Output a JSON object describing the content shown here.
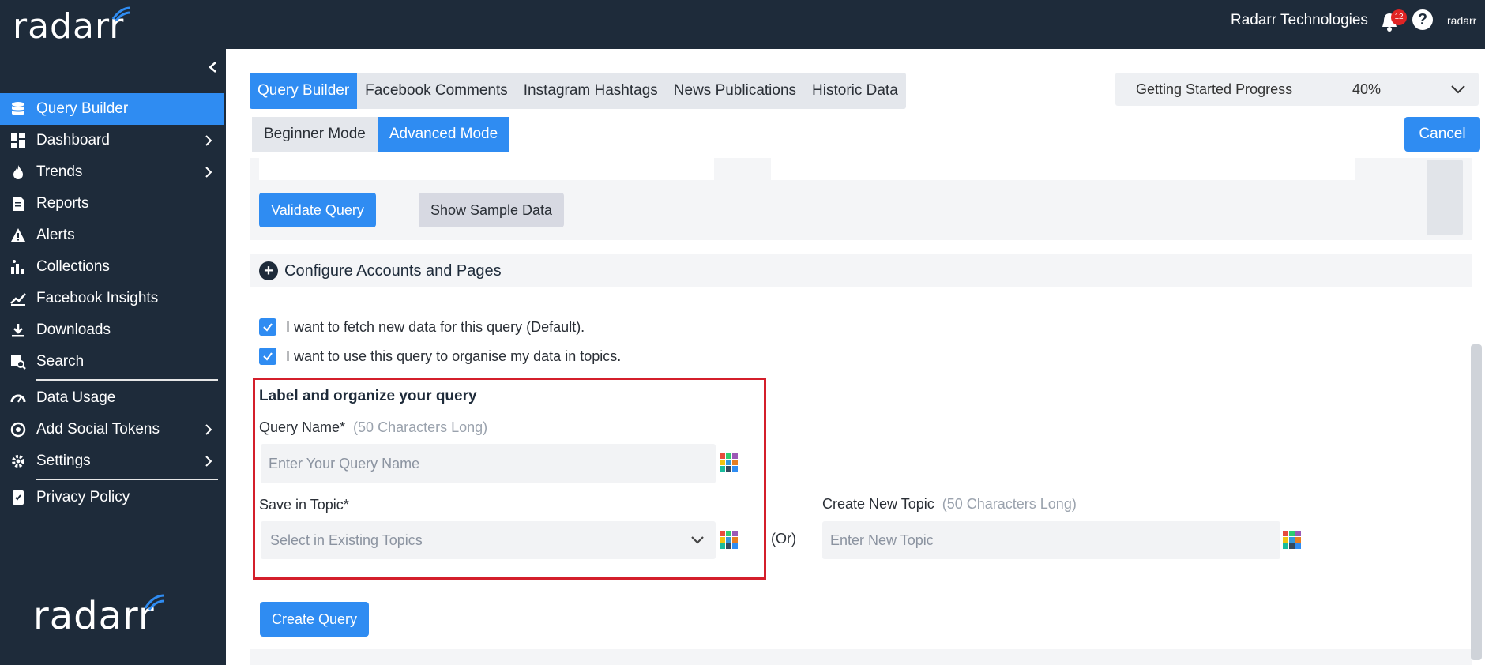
{
  "header": {
    "logo_text": "radarr",
    "org_name": "Radarr Technologies",
    "notification_count": "12",
    "help_symbol": "?",
    "mini_logo": "radarr"
  },
  "sidebar": {
    "items": [
      {
        "label": "Query Builder",
        "icon": "database-icon",
        "active": true
      },
      {
        "label": "Dashboard",
        "icon": "dashboard-icon"
      },
      {
        "label": "Trends",
        "icon": "fire-icon"
      },
      {
        "label": "Reports",
        "icon": "document-icon"
      },
      {
        "label": "Alerts",
        "icon": "alert-icon"
      },
      {
        "label": "Collections",
        "icon": "collections-icon"
      },
      {
        "label": "Facebook Insights",
        "icon": "chart-icon"
      },
      {
        "label": "Downloads",
        "icon": "download-icon"
      },
      {
        "label": "Search",
        "icon": "search-icon"
      },
      {
        "label": "Data Usage",
        "icon": "gauge-icon"
      },
      {
        "label": "Add Social Tokens",
        "icon": "token-icon"
      },
      {
        "label": "Settings",
        "icon": "gear-icon"
      },
      {
        "label": "Privacy Policy",
        "icon": "shield-doc-icon"
      }
    ],
    "footer_logo": "radarr"
  },
  "main": {
    "tabs": [
      "Query Builder",
      "Facebook Comments",
      "Instagram Hashtags",
      "News Publications",
      "Historic Data"
    ],
    "modes": [
      "Beginner Mode",
      "Advanced Mode"
    ],
    "progress": {
      "label": "Getting Started Progress",
      "value": "40%"
    },
    "cancel_label": "Cancel",
    "validate_label": "Validate Query",
    "sample_label": "Show Sample Data",
    "configure_title": "Configure Accounts and Pages",
    "checks": [
      "I want to fetch new data for this query (Default).",
      "I want to use this query to organise my data in topics."
    ],
    "organize": {
      "title": "Label and organize your query",
      "query_name_label": "Query Name*",
      "query_name_hint": "(50 Characters Long)",
      "query_name_placeholder": "Enter Your Query Name",
      "topic_label": "Save in Topic*",
      "topic_placeholder": "Select in Existing Topics",
      "or_text": "(Or)",
      "new_topic_label": "Create New Topic",
      "new_topic_hint": "(50 Characters Long)",
      "new_topic_placeholder": "Enter New Topic"
    },
    "create_label": "Create Query"
  },
  "colors": {
    "primary": "#2f8cf2",
    "sidebar_bg": "#1e2b3a",
    "highlight": "#d41f2b"
  }
}
